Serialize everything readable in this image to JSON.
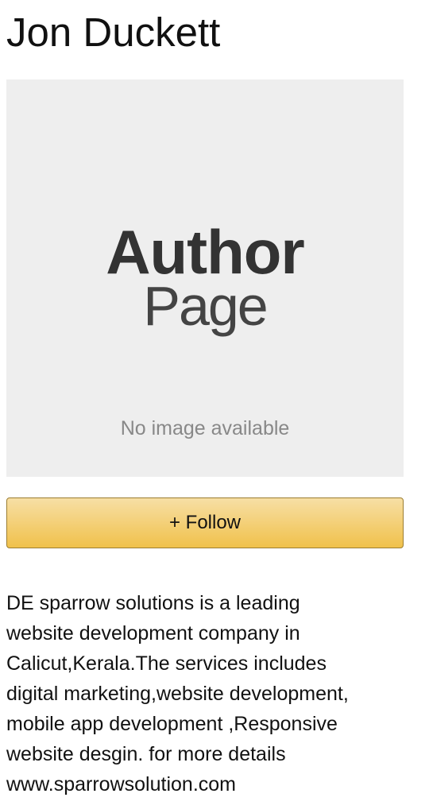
{
  "author": {
    "name": "Jon Duckett"
  },
  "image": {
    "title_bold": "Author",
    "title_light": "Page",
    "caption": "No image available"
  },
  "follow": {
    "label": "+ Follow"
  },
  "bio": {
    "lines": [
      "DE sparrow solutions is a leading",
      "website development company in",
      "Calicut,Kerala.The services includes",
      "digital marketing,website development,",
      "mobile app development ,Responsive",
      "website desgin. for more details",
      "www.sparrowsolution.com"
    ]
  },
  "colors": {
    "button_fill": "#f0c14b",
    "button_border": "#9c7e31",
    "image_background": "#eeeeee"
  }
}
